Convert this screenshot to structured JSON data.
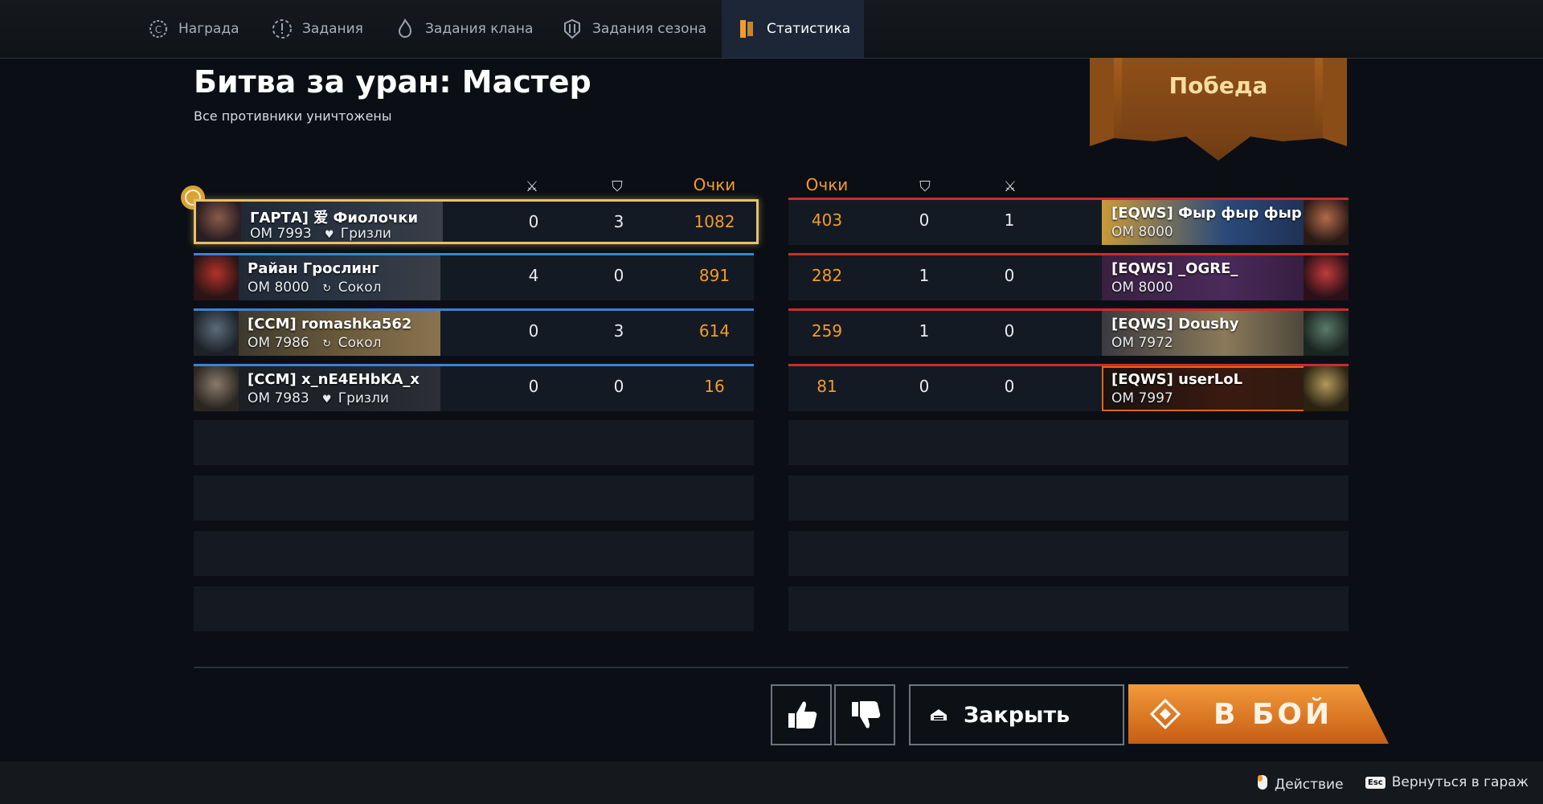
{
  "tabs": [
    {
      "label": "Награда",
      "icon": "reward-gear-icon"
    },
    {
      "label": "Задания",
      "icon": "tasks-alert-icon"
    },
    {
      "label": "Задания клана",
      "icon": "clan-flame-icon"
    },
    {
      "label": "Задания сезона",
      "icon": "season-crown-icon"
    },
    {
      "label": "Статистика",
      "icon": "statistics-bookmark-icon",
      "active": true
    }
  ],
  "battle": {
    "title": "Битва за уран: Мастер",
    "subtitle": "Все противники уничтожены",
    "result": "Победа"
  },
  "headers": {
    "points": "Очки",
    "kills_icon": "kills-icon",
    "assists_icon": "shield-icon"
  },
  "team_left": [
    {
      "name": "ГАРТА] 爱 Фиолочки",
      "om": "ОМ 7993",
      "class": "Гризли",
      "class_icon": "grizzly-heart-icon",
      "kills": "0",
      "assists": "3",
      "points": "1082",
      "highlight": true
    },
    {
      "name": "Райан Грослинг",
      "om": "ОМ 8000",
      "class": "Сокол",
      "class_icon": "falcon-cycle-icon",
      "kills": "4",
      "assists": "0",
      "points": "891"
    },
    {
      "name": "[CCM] romashka562",
      "om": "ОМ 7986",
      "class": "Сокол",
      "class_icon": "falcon-cycle-icon",
      "kills": "0",
      "assists": "3",
      "points": "614"
    },
    {
      "name": "[CCM] x_nE4EHbKA_x",
      "om": "ОМ 7983",
      "class": "Гризли",
      "class_icon": "grizzly-heart-icon",
      "kills": "0",
      "assists": "0",
      "points": "16"
    }
  ],
  "team_right": [
    {
      "name": "[EQWS] Фыр фыр фыр",
      "om": "ОМ 8000",
      "points": "403",
      "assists": "0",
      "kills": "1"
    },
    {
      "name": "[EQWS] _OGRE_",
      "om": "ОМ 8000",
      "points": "282",
      "assists": "1",
      "kills": "0"
    },
    {
      "name": "[EQWS] Doushy",
      "om": "ОМ 7972",
      "points": "259",
      "assists": "1",
      "kills": "0"
    },
    {
      "name": "[EQWS] userLoL",
      "om": "ОМ 7997",
      "points": "81",
      "assists": "0",
      "kills": "0"
    }
  ],
  "buttons": {
    "like": "thumbs-up-icon",
    "dislike": "thumbs-down-icon",
    "close": "Закрыть",
    "fight": "В БОЙ"
  },
  "hints": {
    "action": "Действие",
    "action_key": "mouse-icon",
    "garage": "Вернуться в гараж",
    "garage_key": "Esc"
  },
  "colors": {
    "accent": "#f29b2c",
    "ally": "#3b82d9",
    "enemy": "#d12a2a"
  }
}
